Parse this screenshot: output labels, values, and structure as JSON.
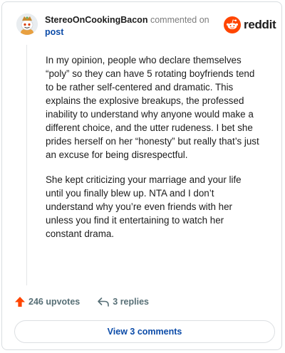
{
  "header": {
    "username": "StereoOnCookingBacon",
    "meta_text": "commented on",
    "post_link": "post"
  },
  "logo": {
    "text": "reddit",
    "icon": "reddit-snoo-icon",
    "color": "#ff4500"
  },
  "avatar": {
    "icon": "snoo-avatar-icon"
  },
  "comment": {
    "paragraphs": [
      "In my opinion, people who declare themselves “poly” so they can have 5 rotating boyfriends tend to be rather self-centered and dramatic. This explains the explosive breakups, the professed inability to understand why anyone would make a different choice, and the utter rudeness. I bet she prides herself on her “honesty” but really that’s just an excuse for being disrespectful.",
      "She kept criticizing your marriage and your life until you finally blew up. NTA and I don’t understand why you’re even friends with her unless you find it entertaining to watch her constant drama."
    ]
  },
  "actions": {
    "upvotes_label": "246 upvotes",
    "upvote_icon": "upvote-arrow-icon",
    "upvote_color": "#ff4500",
    "replies_label": "3 replies",
    "reply_icon": "reply-icon"
  },
  "view_comments_label": "View 3 comments"
}
